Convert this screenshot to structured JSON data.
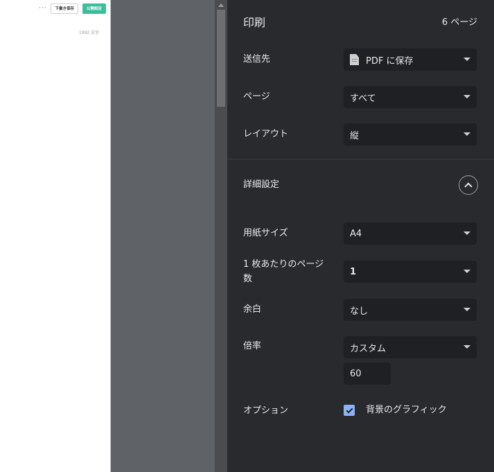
{
  "preview": {
    "toolbar": {
      "more_label": "···",
      "draft_label": "下書き保存",
      "publish_label": "公開設定"
    },
    "word_count": "1992 文字"
  },
  "panel": {
    "title": "印刷",
    "page_count": "6 ページ",
    "destination": {
      "label": "送信先",
      "value": "PDF に保存",
      "icon": "pdf-file-icon"
    },
    "pages": {
      "label": "ページ",
      "value": "すべて"
    },
    "layout": {
      "label": "レイアウト",
      "value": "縦"
    },
    "advanced": {
      "label": "詳細設定",
      "icon": "chevron-up-icon"
    },
    "paper_size": {
      "label": "用紙サイズ",
      "value": "A4"
    },
    "pages_per_sheet": {
      "label_line1": "1 枚あたりのページ",
      "label_line2": "数",
      "value": "1"
    },
    "margins": {
      "label": "余白",
      "value": "なし"
    },
    "scale": {
      "label": "倍率",
      "value": "カスタム",
      "custom_value": "60"
    },
    "options": {
      "label": "オプション",
      "background_graphics": "背景のグラフィック",
      "checked": true
    }
  },
  "colors": {
    "panel_bg": "#292a2d",
    "field_bg": "#1f2023",
    "accent": "#8ab4f8",
    "publish_green": "#3dbd9b"
  }
}
